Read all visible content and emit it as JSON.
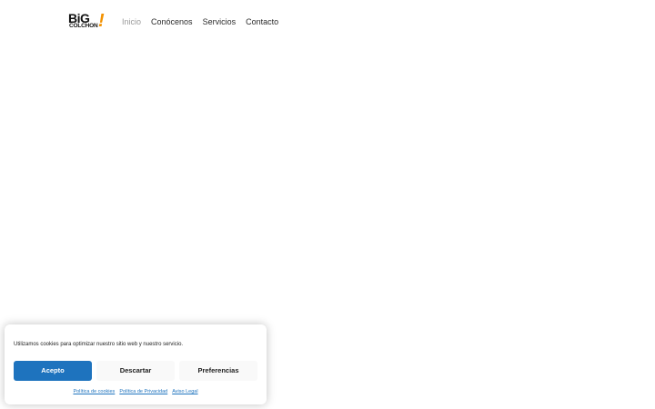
{
  "header": {
    "logo": {
      "main": "BiG",
      "sub": "COLCHON",
      "mark": "!"
    },
    "nav": [
      {
        "label": "Inicio",
        "active": true
      },
      {
        "label": "Conócenos",
        "active": false
      },
      {
        "label": "Servicios",
        "active": false
      },
      {
        "label": "Contacto",
        "active": false
      }
    ]
  },
  "cookie_banner": {
    "message": "Utilizamos cookies para optimizar nuestro sitio web y nuestro servicio.",
    "accept_label": "Acepto",
    "deny_label": "Descartar",
    "preferences_label": "Preferencias",
    "links": [
      {
        "label": "Política de cookies"
      },
      {
        "label": "Política de Privacidad"
      },
      {
        "label": "Aviso Legal"
      }
    ]
  },
  "colors": {
    "accent": "#1e73be",
    "logo_mark": "#f39200",
    "nav_active": "#9a9a9a",
    "nav_text": "#2b2b2b"
  }
}
